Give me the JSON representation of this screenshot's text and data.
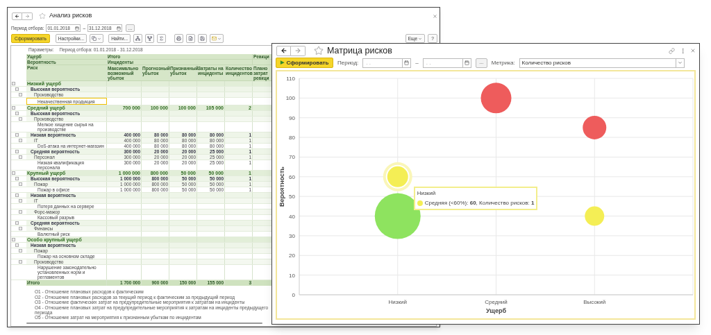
{
  "report_window": {
    "title": "Анализ рисков",
    "period_label": "Период отбора:",
    "date_from": "01.01.2018",
    "date_separator": "–",
    "date_to": "31.12.2018",
    "period_button": "...",
    "toolbar": {
      "generate": "Сформировать",
      "settings": "Настройки...",
      "find": "Найти...",
      "more": "Еще",
      "help": "?"
    },
    "parameters_label": "Параметры:",
    "parameters_value": "Период отбора: 01.01.2018 - 31.12.2018",
    "dimension_labels": [
      "Ущерб",
      "Вероятность",
      "Риск"
    ],
    "group_total": "Итого",
    "group_incidents": "Инциденты",
    "group_reaction": "Реакци",
    "columns": [
      "Максимально возможный убыток",
      "Прогнозный убыток",
      "Признанный убыток",
      "Затраты на инциденты",
      "Количество инцидентов",
      "Плано затрат реакци"
    ],
    "rows": [
      {
        "label": "Низкий ущерб",
        "selected": false,
        "children": [
          {
            "label": "Высокая вероятность",
            "selected": false,
            "children": [
              {
                "label": "Производство",
                "selected": false,
                "children": [
                  {
                    "label": "Некачественная продукция",
                    "selected": true
                  }
                ]
              }
            ]
          }
        ]
      },
      {
        "label": "Средний ущерб",
        "selected": false,
        "values": [
          "700 000",
          "100 000",
          "100 000",
          "105 000",
          "2"
        ],
        "children": [
          {
            "label": "Высокая вероятность",
            "selected": false,
            "children": [
              {
                "label": "Производство",
                "selected": false,
                "children": [
                  {
                    "label": "Мелкое хищение сырья на производстве",
                    "selected": false
                  }
                ]
              }
            ]
          },
          {
            "label": "Низкая вероятность",
            "selected": false,
            "values": [
              "400 000",
              "80 000",
              "80 000",
              "80 000",
              "1"
            ],
            "children": [
              {
                "label": "IT",
                "selected": false,
                "values": [
                  "400 000",
                  "80 000",
                  "80 000",
                  "80 000",
                  "1"
                ],
                "children": [
                  {
                    "label": "DoS-атака на интернет-магазин",
                    "selected": false,
                    "values": [
                      "400 000",
                      "80 000",
                      "80 000",
                      "80 000",
                      "1"
                    ]
                  }
                ]
              }
            ]
          },
          {
            "label": "Средняя вероятность",
            "selected": false,
            "values": [
              "300 000",
              "20 000",
              "20 000",
              "25 000",
              "1"
            ],
            "children": [
              {
                "label": "Персонал",
                "selected": false,
                "values": [
                  "300 000",
                  "20 000",
                  "20 000",
                  "25 000",
                  "1"
                ],
                "children": [
                  {
                    "label": "Низкая квалификация персонала",
                    "selected": false,
                    "values": [
                      "300 000",
                      "20 000",
                      "20 000",
                      "25 000",
                      "1"
                    ]
                  }
                ]
              }
            ]
          }
        ]
      },
      {
        "label": "Крупный ущерб",
        "selected": false,
        "values": [
          "1 000 000",
          "800 000",
          "50 000",
          "50 000",
          "1"
        ],
        "children": [
          {
            "label": "Высокая вероятность",
            "selected": false,
            "values": [
              "1 000 000",
              "800 000",
              "50 000",
              "50 000",
              "1"
            ],
            "children": [
              {
                "label": "Пожар",
                "selected": false,
                "values": [
                  "1 000 000",
                  "800 000",
                  "50 000",
                  "50 000",
                  "1"
                ],
                "children": [
                  {
                    "label": "Пожар в офисе",
                    "selected": false,
                    "values": [
                      "1 000 000",
                      "800 000",
                      "50 000",
                      "50 000",
                      "1"
                    ]
                  }
                ]
              }
            ]
          },
          {
            "label": "Низкая вероятность",
            "selected": false,
            "children": [
              {
                "label": "IT",
                "selected": false,
                "children": [
                  {
                    "label": "Потеря данных на сервере",
                    "selected": false
                  }
                ]
              },
              {
                "label": "Форс-мажор",
                "selected": false,
                "children": [
                  {
                    "label": "Кассовый разрыв",
                    "selected": false
                  }
                ]
              }
            ]
          },
          {
            "label": "Средняя вероятность",
            "selected": false,
            "children": [
              {
                "label": "Финансы",
                "selected": false,
                "children": [
                  {
                    "label": "Валютный риск",
                    "selected": false
                  }
                ]
              }
            ]
          }
        ]
      },
      {
        "label": "Особо крупный ущерб",
        "selected": false,
        "children": [
          {
            "label": "Низкая вероятность",
            "selected": false,
            "children": [
              {
                "label": "Пожар",
                "selected": false,
                "children": [
                  {
                    "label": "Пожар на основном складе",
                    "selected": false
                  }
                ]
              },
              {
                "label": "Производство",
                "selected": false,
                "children": [
                  {
                    "label": "Нарушение законодательно установленных норм и регламентов",
                    "selected": false
                  }
                ]
              }
            ]
          }
        ]
      }
    ],
    "total": {
      "label": "Итого",
      "values": [
        "1 700 000",
        "900 000",
        "150 000",
        "155 000",
        "3"
      ]
    },
    "footnotes": [
      "О1 - Отношение плановых расходов к фактическим",
      "О2 - Отношение плановых расходов за текущий период к фактическим за предыдущий период",
      "О3 - Отношение фактических затрат на предупредительные мероприятия к затратам на инциденты",
      "О4 - Отношение плановых затрат на предупредительные мероприятия к затратам на инциденты предыдущего периода",
      "О5 - Отношение затрат на мероприятия к признанным убыткам по инцидентам"
    ]
  },
  "matrix_window": {
    "title": "Матрица рисков",
    "generate_button": "Сформировать",
    "generate_glyph": "▶",
    "period_label": "Период:",
    "date_from": ". .",
    "date_separator": "–",
    "date_to": ". .",
    "period_button": "...",
    "metric_label": "Метрика:",
    "metric_value": "Количество рисков",
    "chart_data": {
      "type": "scatter",
      "grid": true,
      "xlabel": "Ущерб",
      "ylabel": "Вероятность",
      "categories": [
        "Низкий",
        "Средний",
        "Высокий"
      ],
      "ylim": [
        0,
        110
      ],
      "yticks": [
        0,
        10,
        20,
        30,
        40,
        50,
        60,
        70,
        80,
        90,
        100,
        110
      ],
      "series": [
        {
          "color": "#8ee35f",
          "values": [
            40,
            null,
            null
          ]
        },
        {
          "color": "#f4ee55",
          "values": [
            60,
            null,
            40
          ]
        },
        {
          "color": "#ee5c5c",
          "values": [
            null,
            100,
            85
          ]
        }
      ]
    },
    "tooltip": {
      "title": "Низкий",
      "text": "Средняя (<60%): **60**, Количество рисков: **1**",
      "color": "#f4ee55"
    }
  }
}
